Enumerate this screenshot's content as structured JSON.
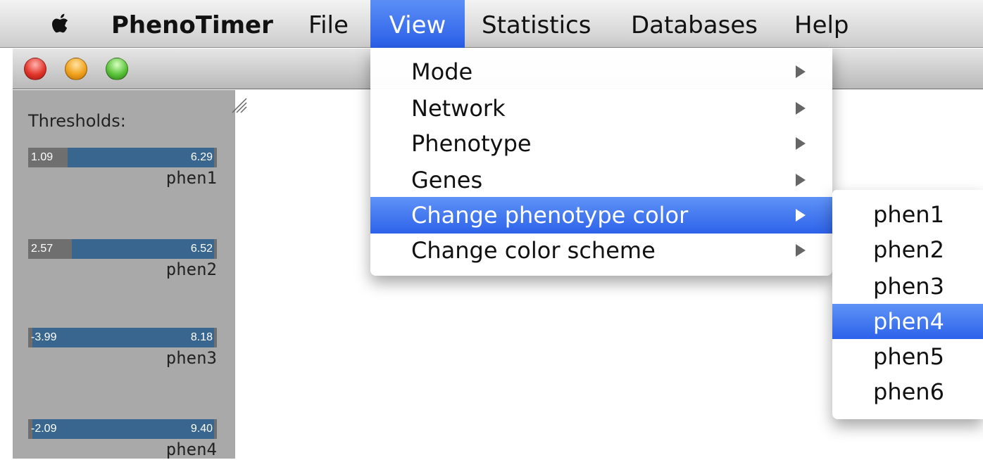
{
  "menubar": {
    "app_name": "PhenoTimer",
    "items": [
      "File",
      "View",
      "Statistics",
      "Databases",
      "Help"
    ]
  },
  "sidepanel": {
    "title": "Thresholds:",
    "rows": [
      {
        "low": "1.09",
        "high": "6.29",
        "name": "phen1"
      },
      {
        "low": "2.57",
        "high": "6.52",
        "name": "phen2"
      },
      {
        "low": "-3.99",
        "high": "8.18",
        "name": "phen3"
      },
      {
        "low": "-2.09",
        "high": "9.40",
        "name": "phen4"
      }
    ]
  },
  "view_menu": {
    "items": [
      {
        "label": "Mode"
      },
      {
        "label": "Network"
      },
      {
        "label": "Phenotype"
      },
      {
        "label": "Genes"
      },
      {
        "label": "Change phenotype color"
      },
      {
        "label": "Change color scheme"
      }
    ],
    "highlighted": "Change phenotype color"
  },
  "submenu": {
    "items": [
      "phen1",
      "phen2",
      "phen3",
      "phen4",
      "phen5",
      "phen6"
    ],
    "highlighted": "phen4"
  },
  "colors": {
    "accent": "#2d62ea",
    "bar_fill": "#38668e",
    "panel_bg": "#a9a9a9"
  },
  "icons": {
    "apple": "apple-logo-icon",
    "arrow": "chevron-right-icon",
    "grip": "resize-grip-icon"
  }
}
